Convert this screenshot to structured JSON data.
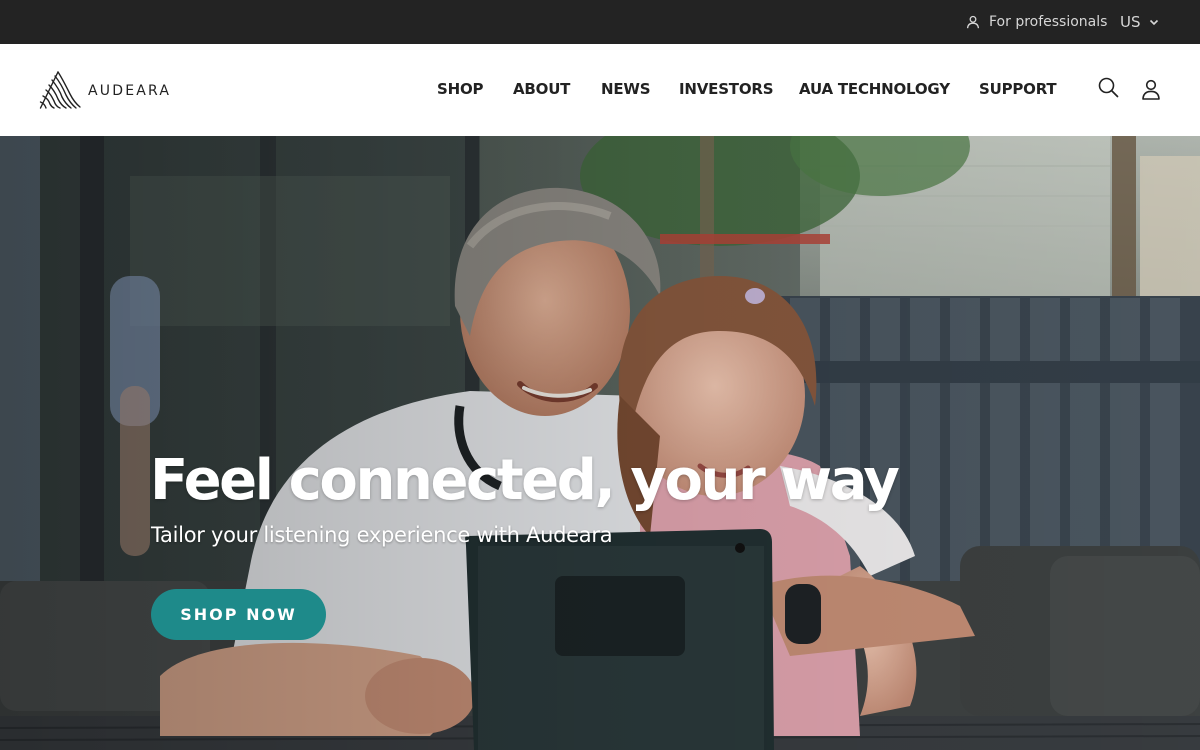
{
  "top_bar": {
    "professionals_label": "For professionals",
    "region_label": "US",
    "icons": {
      "professionals": "person-outline-icon",
      "region_dropdown": "chevron-down-icon"
    }
  },
  "header": {
    "brand": {
      "name": "AUDEARA",
      "icon": "audeara-wave-logo"
    },
    "nav": [
      {
        "label": "SHOP"
      },
      {
        "label": "ABOUT"
      },
      {
        "label": "NEWS"
      },
      {
        "label": "INVESTORS"
      },
      {
        "label": "AUA TECHNOLOGY"
      },
      {
        "label": "SUPPORT"
      }
    ],
    "icons": {
      "search": "search-icon",
      "account": "account-icon"
    }
  },
  "hero": {
    "title": "Feel connected, your way",
    "subtitle": "Tailor your listening experience with Audeara",
    "cta_label": "SHOP NOW",
    "image": "Grandfather and young girl smiling at a tablet outdoors"
  },
  "colors": {
    "top_bar_bg": "#232323",
    "header_bg": "#ffffff",
    "nav_text": "#222222",
    "cta_bg": "#1e8a8a",
    "hero_text": "#ffffff"
  }
}
